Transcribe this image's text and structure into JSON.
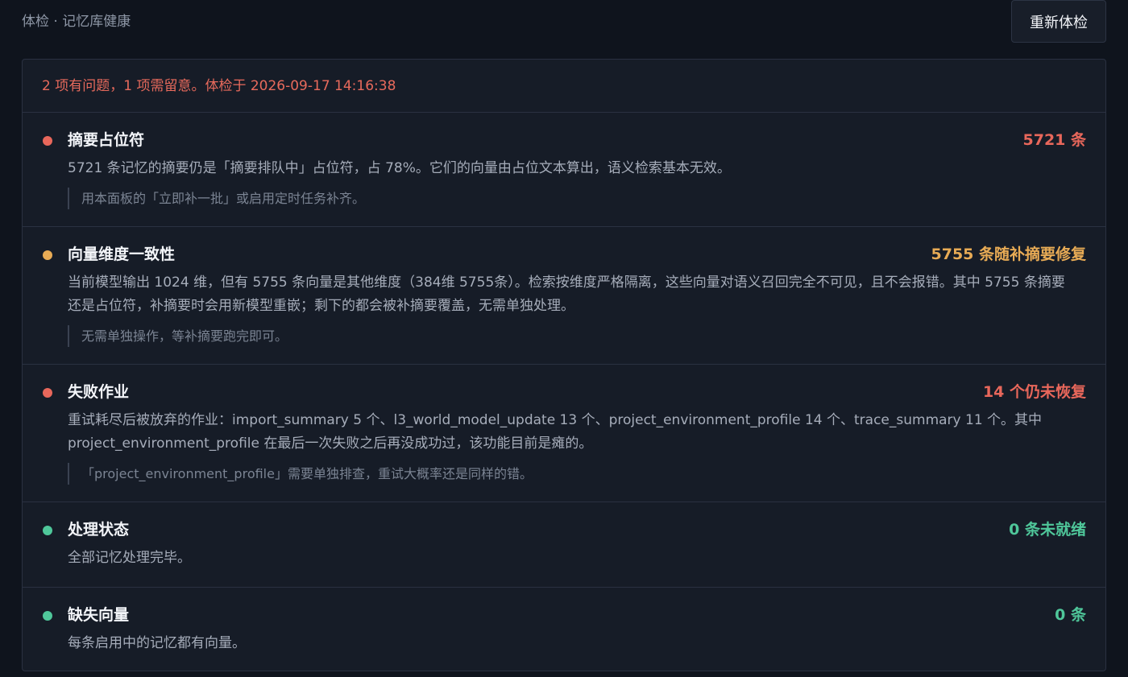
{
  "header": {
    "breadcrumb": "体检 · 记忆库健康",
    "recheck_label": "重新体检"
  },
  "summary": {
    "text": "2 项有问题，1 项需留意。体检于 2026-09-17 14:16:38"
  },
  "colors": {
    "problem": "#e8675b",
    "warning": "#e8ab55",
    "ok": "#4fc79a"
  },
  "items": [
    {
      "status": "problem",
      "title": "摘要占位符",
      "metric": "5721 条",
      "desc": "5721 条记忆的摘要仍是「摘要排队中」占位符，占 78%。它们的向量由占位文本算出，语义检索基本无效。",
      "hint": "用本面板的「立即补一批」或启用定时任务补齐。"
    },
    {
      "status": "warning",
      "title": "向量维度一致性",
      "metric": "5755 条随补摘要修复",
      "desc": "当前模型输出 1024 维，但有 5755 条向量是其他维度（384维 5755条）。检索按维度严格隔离，这些向量对语义召回完全不可见，且不会报错。其中 5755 条摘要还是占位符，补摘要时会用新模型重嵌；剩下的都会被补摘要覆盖，无需单独处理。",
      "hint": "无需单独操作，等补摘要跑完即可。"
    },
    {
      "status": "problem",
      "title": "失败作业",
      "metric": "14 个仍未恢复",
      "desc": "重试耗尽后被放弃的作业：import_summary 5 个、l3_world_model_update 13 个、project_environment_profile 14 个、trace_summary 11 个。其中 project_environment_profile 在最后一次失败之后再没成功过，该功能目前是瘫的。",
      "hint": "「project_environment_profile」需要单独排查，重试大概率还是同样的错。"
    },
    {
      "status": "ok",
      "title": "处理状态",
      "metric": "0 条未就绪",
      "desc": "全部记忆处理完毕。"
    },
    {
      "status": "ok",
      "title": "缺失向量",
      "metric": "0 条",
      "desc": "每条启用中的记忆都有向量。"
    }
  ]
}
